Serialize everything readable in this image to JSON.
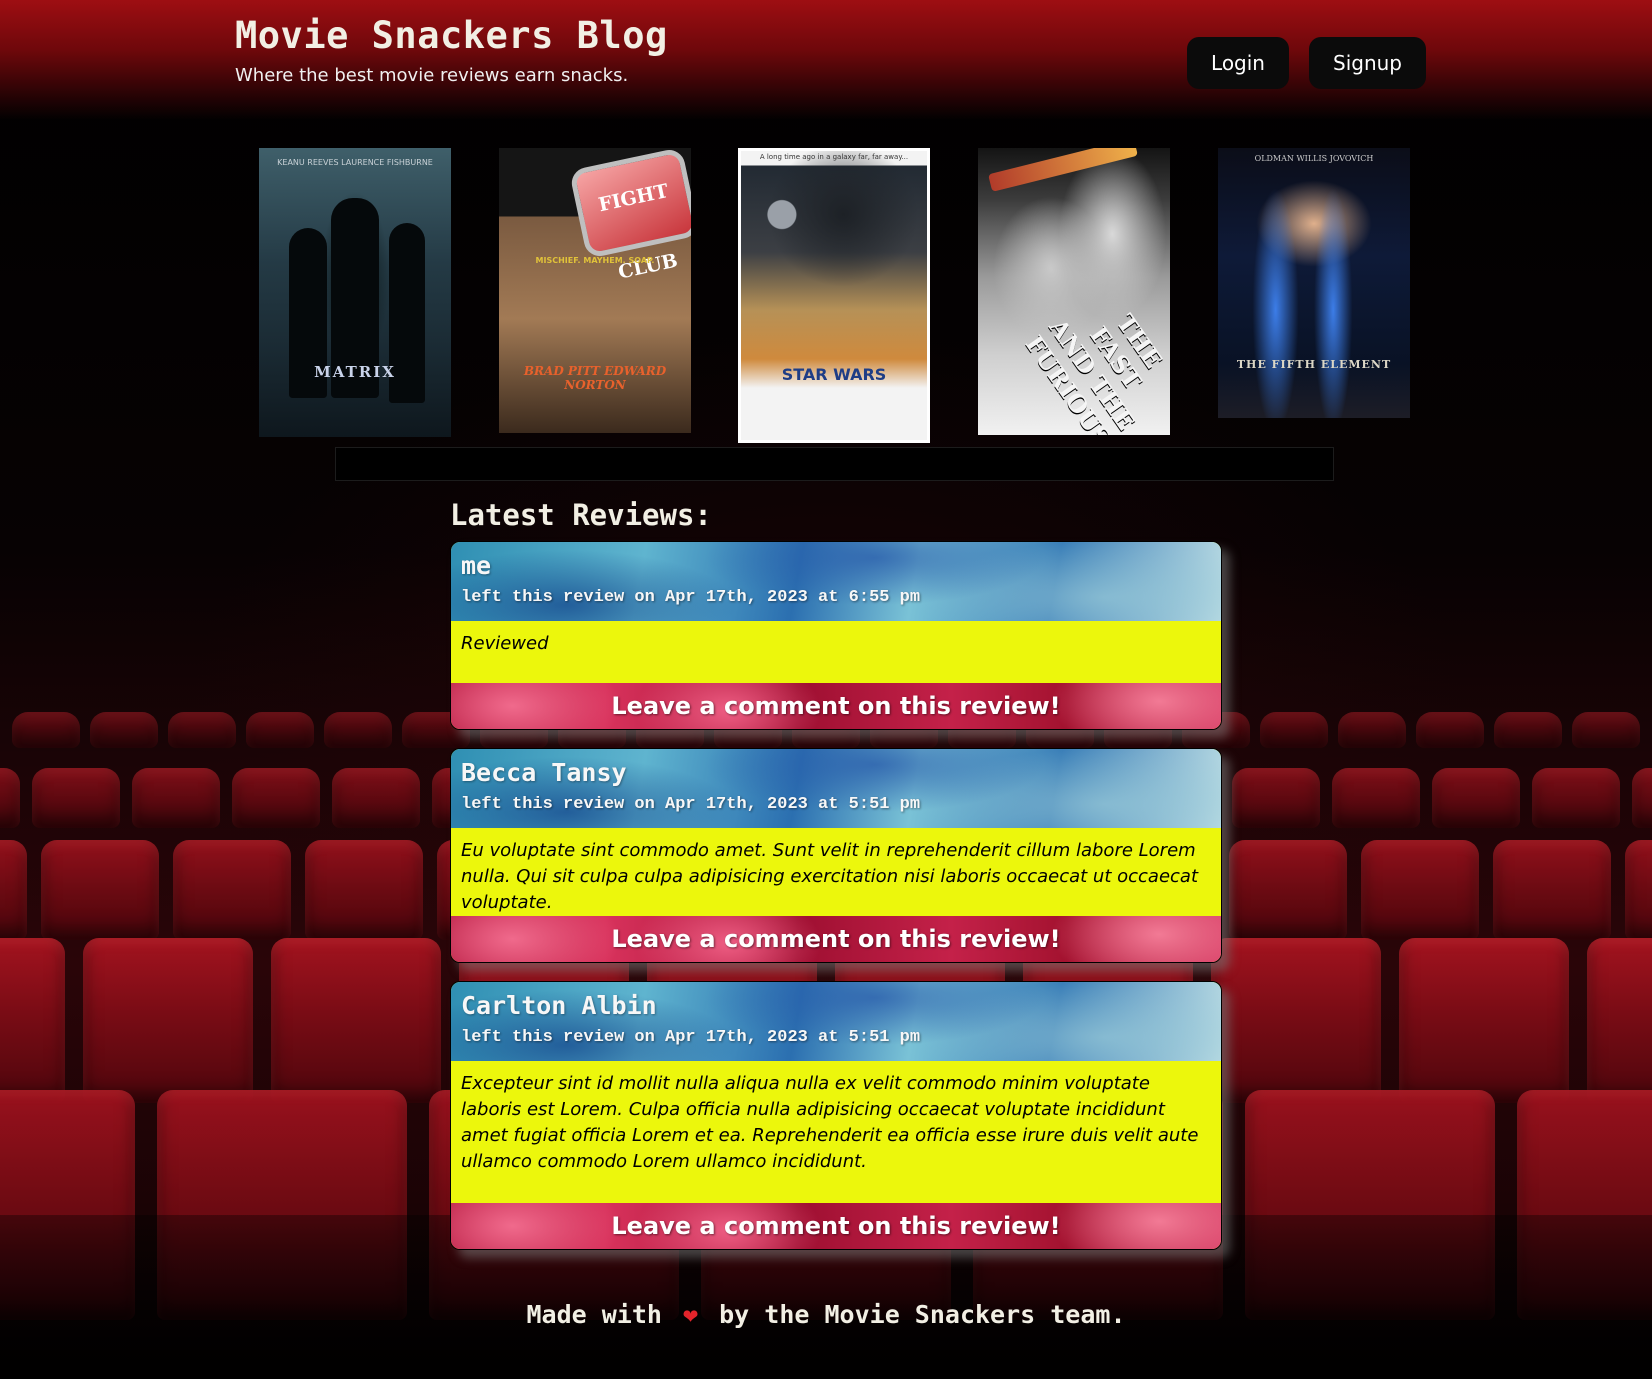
{
  "header": {
    "title": "Movie Snackers Blog",
    "tagline": "Where the best movie reviews earn snacks.",
    "login_label": "Login",
    "signup_label": "Signup"
  },
  "posters": [
    {
      "title": "MATRIX",
      "credits": "KEANU REEVES   LAURENCE FISHBURNE"
    },
    {
      "title": "BRAD PITT EDWARD NORTON",
      "tagline": "MISCHIEF. MAYHEM. SOAP.",
      "logo": "FIGHT CLUB"
    },
    {
      "title": "STAR WARS",
      "small": "A long time ago in a galaxy far, far away..."
    },
    {
      "title": "THE FAST AND THE FURIOUS"
    },
    {
      "title": "THE FIFTH ELEMENT",
      "names": "OLDMAN   WILLIS   JOVOVICH"
    }
  ],
  "reviews_heading": "Latest Reviews:",
  "reviews": [
    {
      "author": "me",
      "meta": "left this review on Apr 17th, 2023 at 6:55 pm",
      "body": "Reviewed",
      "comment_label": "Leave a comment on this review!"
    },
    {
      "author": "Becca Tansy",
      "meta": "left this review on Apr 17th, 2023 at 5:51 pm",
      "body": "Eu voluptate sint commodo amet. Sunt velit in reprehenderit cillum labore Lorem nulla. Qui sit culpa culpa adipisicing exercitation nisi laboris occaecat ut occaecat voluptate.",
      "comment_label": "Leave a comment on this review!"
    },
    {
      "author": "Carlton Albin",
      "meta": "left this review on Apr 17th, 2023 at 5:51 pm",
      "body": "Excepteur sint id mollit nulla aliqua nulla ex velit commodo minim voluptate laboris est Lorem. Culpa officia nulla adipisicing occaecat voluptate incididunt amet fugiat officia Lorem et ea. Reprehenderit ea officia esse irure duis velit aute ullamco commodo Lorem ullamco incididunt.",
      "comment_label": "Leave a comment on this review!"
    }
  ],
  "footer": {
    "prefix": "Made with",
    "heart_icon": "heart-icon",
    "suffix": "by the Movie Snackers team."
  },
  "colors": {
    "header_red": "#9e0e12",
    "review_body_yellow": "#ecf70c",
    "button_bg": "#0b0b0b"
  }
}
